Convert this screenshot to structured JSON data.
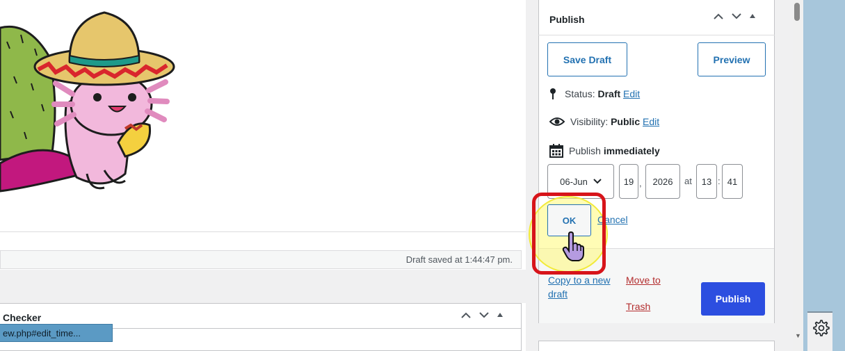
{
  "editor": {
    "draft_saved_text": "Draft saved at 1:44:47 pm.",
    "checker_title": "Checker",
    "url_tooltip": "ew.php#edit_time..."
  },
  "publish": {
    "title": "Publish",
    "save_draft_label": "Save Draft",
    "preview_label": "Preview",
    "status_label": "Status:",
    "status_value": "Draft",
    "visibility_label": "Visibility:",
    "visibility_value": "Public",
    "edit_label": "Edit",
    "publish_label": "Publish",
    "publish_when": "immediately",
    "date": {
      "month": "06-Jun",
      "day": "19",
      "comma": ",",
      "year": "2026",
      "at": "at",
      "hour": "13",
      "colon": ":",
      "minute": "41"
    },
    "ok_label": "OK",
    "cancel_label": "Cancel",
    "copy_to_draft_label": "Copy to a new draft",
    "move_to_trash_label": "Move to Trash",
    "publish_button_label": "Publish"
  },
  "colors": {
    "accent": "#2271b1",
    "publish_button": "#2c4ee0",
    "trash": "#b32d2e",
    "highlight_box": "#d7141a",
    "highlight_circle": "#f2ea3a",
    "right_strip": "#a7c6db"
  },
  "icons": {
    "status": "pin-icon",
    "visibility": "eye-icon",
    "schedule": "calendar-icon",
    "cursor": "hand-pointer-icon",
    "settings": "gear-icon"
  }
}
